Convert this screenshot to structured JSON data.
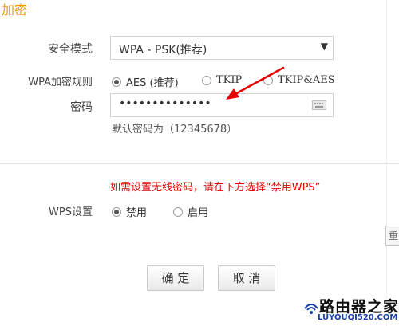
{
  "header": {
    "title": "加密"
  },
  "form": {
    "security_mode": {
      "label": "安全模式",
      "value": "WPA - PSK(推荐)"
    },
    "wpa_rule": {
      "label": "WPA加密规则",
      "options": [
        {
          "label": "AES (推荐)",
          "checked": true
        },
        {
          "label": "TKIP",
          "checked": false
        },
        {
          "label": "TKIP&AES",
          "checked": false
        }
      ]
    },
    "password": {
      "label": "密码",
      "masked_value": "••••••••••••••",
      "hint": "默认密码为（12345678）"
    }
  },
  "wps": {
    "warning": "如需设置无线密码，请在下方选择“禁用WPS”",
    "label": "WPS设置",
    "options": [
      {
        "label": "禁用",
        "checked": true
      },
      {
        "label": "启用",
        "checked": false
      }
    ]
  },
  "buttons": {
    "confirm": "确 定",
    "cancel": "取 消",
    "side": "重"
  },
  "watermark": {
    "brand": "路由器之家",
    "url": "LUYOUQI520.COM"
  },
  "colors": {
    "accent": "#f39800",
    "warning": "#e60000",
    "arrow": "#e60000"
  }
}
